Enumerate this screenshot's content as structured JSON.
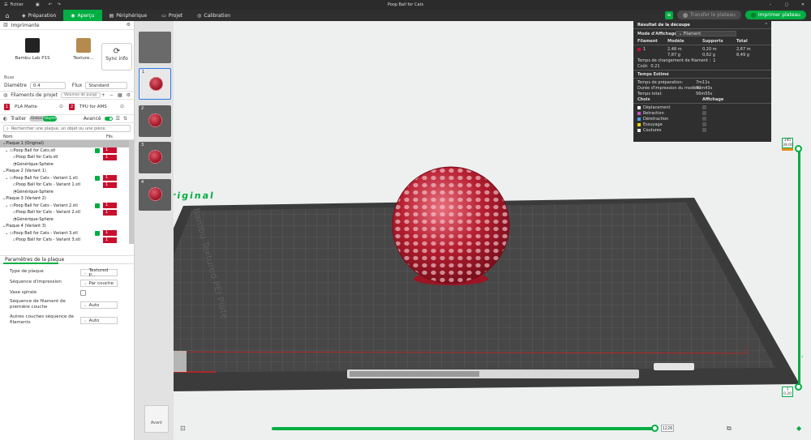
{
  "titlebar": {
    "menu_label": "Fichier",
    "title": "Poop Ball for Cats"
  },
  "tabs": [
    {
      "label": "Préparation",
      "active": false,
      "icon": "cube-icon"
    },
    {
      "label": "Aperçu",
      "active": true,
      "icon": "eye-icon"
    },
    {
      "label": "Périphérique",
      "active": false,
      "icon": "device-icon"
    },
    {
      "label": "Projet",
      "active": false,
      "icon": "folder-icon"
    },
    {
      "label": "Calibration",
      "active": false,
      "icon": "gauge-icon"
    }
  ],
  "actions": {
    "send_label": "Transfer le plateau",
    "print_label": "Imprimer plateau"
  },
  "printer": {
    "section_title": "Imprimante",
    "name": "Bambu Lab P1S",
    "plate": "Texture...",
    "sync_label": "Sync info"
  },
  "nozzle": {
    "section_label": "Buse",
    "diameter_label": "Diamètre",
    "diameter_value": "0.4",
    "flow_label": "Flux",
    "flow_value": "Standard"
  },
  "filaments": {
    "section_title": "Filaments de projet",
    "purge_label": "Volumes de purge",
    "items": [
      {
        "num": "1",
        "name": "PLA Matte",
        "color": "#c8102e"
      },
      {
        "num": "2",
        "name": "TPU for AMS",
        "color": "#c8102e"
      }
    ]
  },
  "objects": {
    "tab_label": "Traiter",
    "toggle_global": "Global",
    "toggle_objects": "Objets",
    "advanced_label": "Avancé",
    "search_placeholder": "Rechercher une plaque, un objet ou une pièce.",
    "col_name": "Nom",
    "col_fil": "Fils",
    "tree": [
      {
        "kind": "plate",
        "label": "Plaque 1 (Original)",
        "selected": true
      },
      {
        "kind": "object",
        "label": "Poop Ball for Cats.stl",
        "fil": "1"
      },
      {
        "kind": "part",
        "label": "Poop Ball for Cats.stl",
        "fil": "1"
      },
      {
        "kind": "modifier",
        "label": "Générique-Sphère"
      },
      {
        "kind": "plate",
        "label": "Plaque 2 (Variant 1)"
      },
      {
        "kind": "object",
        "label": "Poop Ball for Cats - Variant 1.stl",
        "fil": "1"
      },
      {
        "kind": "part",
        "label": "Poop Ball for Cats - Variant 1.stl",
        "fil": "1"
      },
      {
        "kind": "modifier",
        "label": "Générique-Sphère"
      },
      {
        "kind": "plate",
        "label": "Plaque 3 (Variant 2)"
      },
      {
        "kind": "object",
        "label": "Poop Ball for Cats - Variant 2.stl",
        "fil": "1"
      },
      {
        "kind": "part",
        "label": "Poop Ball for Cats - Variant 2.stl",
        "fil": "1"
      },
      {
        "kind": "modifier",
        "label": "Générique-Sphère"
      },
      {
        "kind": "plate",
        "label": "Plaque 4 (Variant 3)"
      },
      {
        "kind": "object",
        "label": "Poop Ball for Cats - Variant 3.stl",
        "fil": "1"
      },
      {
        "kind": "part",
        "label": "Poop Ball for Cats - Variant 3.stl",
        "fil": "1"
      }
    ]
  },
  "plate_params": {
    "title": "Paramètres de la plaque",
    "type_label": "Type de plaque",
    "type_value": "Textured P...",
    "sequence_label": "Séquence d'impression",
    "sequence_value": "Par couche",
    "spiral_label": "Vase spirale",
    "first_layer_label": "Séquence de filament de première couche",
    "first_layer_value": "Auto",
    "other_layers_label": "Autres couches séquence de filaments",
    "other_layers_value": "Auto"
  },
  "thumbnails": [
    {
      "num": "",
      "selected": false,
      "empty": true
    },
    {
      "num": "1",
      "selected": true,
      "empty": false
    },
    {
      "num": "2",
      "selected": false,
      "empty": false
    },
    {
      "num": "3",
      "selected": false,
      "empty": false
    },
    {
      "num": "4",
      "selected": false,
      "empty": false
    }
  ],
  "scene": {
    "plate_label": "Original",
    "bed_text": "Bambu Textured PEI Plate"
  },
  "result": {
    "title": "Résultat de la découpe",
    "mode_label": "Mode d'Affichage",
    "mode_value": "Filament",
    "headers": {
      "filament": "Filament",
      "model": "Modèle",
      "supports": "Supports",
      "total": "Total"
    },
    "row": {
      "num": "1",
      "model_m": "2,48 m",
      "model_g": "7,87 g",
      "sup_m": "0,20 m",
      "sup_g": "0,62 g",
      "tot_m": "2,67 m",
      "tot_g": "8,49 g"
    },
    "change_label": "Temps de changement de filament :",
    "change_value": "1",
    "cost_label": "Coût:",
    "cost_value": "0.21",
    "time_title": "Temps Estimé",
    "prep_label": "Temps de préparation:",
    "prep_value": "7m11s",
    "model_time_label": "Durée d'impression du modèle:",
    "model_time_value": "49m43s",
    "total_label": "Temps total:",
    "total_value": "56m55s",
    "choice_label": "Choix",
    "display_label": "Affichage",
    "legend": [
      {
        "label": "Déplacement",
        "color": "#ffffff"
      },
      {
        "label": "Retraction",
        "color": "#c653c6"
      },
      {
        "label": "Déretraction",
        "color": "#4aa0ff"
      },
      {
        "label": "Essuyage",
        "color": "#ffd400"
      },
      {
        "label": "Coutures",
        "color": "#e8e8e8"
      }
    ]
  },
  "layer_slider": {
    "top_layer": "195",
    "top_height": "39.00",
    "bottom_layer": "1",
    "bottom_height": "0.20",
    "progress_fraction": 1.0
  },
  "move_slider": {
    "value": "1226",
    "progress_fraction": 1.0
  },
  "navcube": {
    "label": "Avant"
  },
  "colors": {
    "accent": "#00ae42",
    "filament": "#c8102e"
  }
}
